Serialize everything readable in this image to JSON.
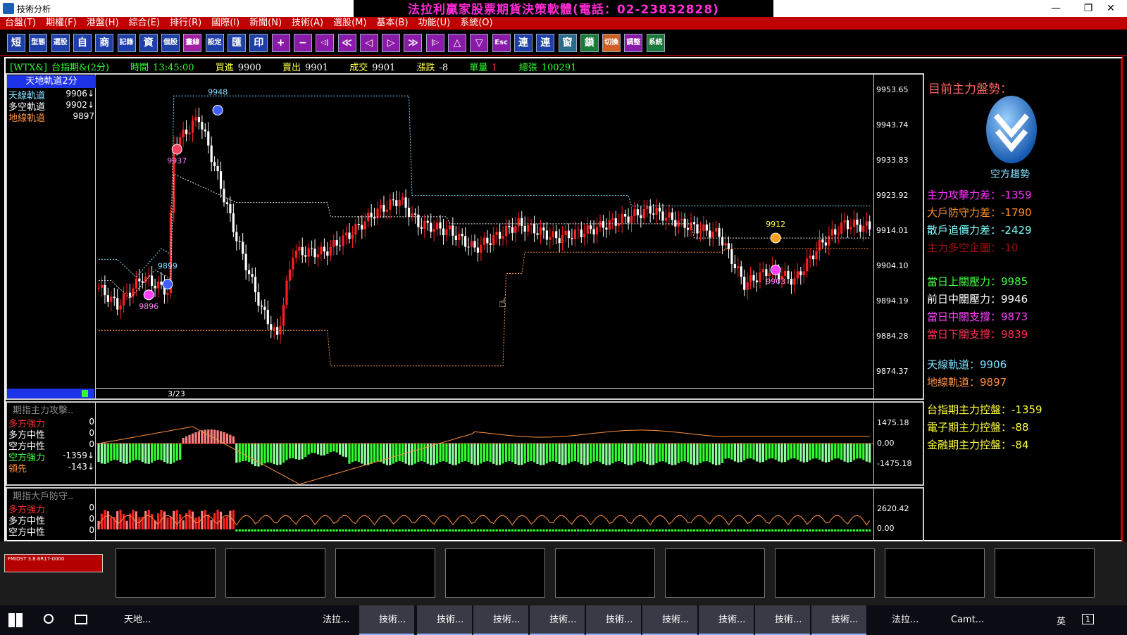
{
  "window": {
    "title": "技術分析",
    "banner": "法拉利贏家股票期貨決策軟體(電話：02-23832828)",
    "minimize": "—",
    "maximize": "❐",
    "close": "✕"
  },
  "menu": [
    "台盤(T)",
    "期權(F)",
    "港盤(H)",
    "綜合(E)",
    "排行(R)",
    "國際(I)",
    "新聞(N)",
    "技術(A)",
    "選股(M)",
    "基本(B)",
    "功能(U)",
    "系統(O)"
  ],
  "toolbar": [
    "短",
    "型態",
    "選股",
    "自",
    "商",
    "記錄",
    "資",
    "個股",
    "畫線",
    "設定",
    "匯",
    "印",
    "+",
    "−",
    "◁|",
    "≪",
    "◁",
    "▷",
    "≫",
    "|▷",
    "△",
    "▽",
    "Esc",
    "連",
    "連",
    "窗",
    "鎖",
    "切換",
    "調整",
    "系統"
  ],
  "quote": {
    "symbol": "[WTX&]",
    "name": "台指期&(2分)",
    "time_label": "時間",
    "time": "13:45:00",
    "bid_label": "買進",
    "bid": "9900",
    "ask_label": "賣出",
    "ask": "9901",
    "trade_label": "成交",
    "trade": "9901",
    "change_label": "漲跌",
    "change": "-8",
    "vol_label": "單量",
    "vol": "1",
    "total_label": "總張",
    "total": "100291"
  },
  "main_panel": {
    "title": "天地軌道2分",
    "legend": [
      {
        "label": "天線軌道",
        "value": "9906↓",
        "color": "#7fe0ff"
      },
      {
        "label": "多空軌道",
        "value": "9902↓",
        "color": "#ffffff"
      },
      {
        "label": "地線軌道",
        "value": "9897",
        "color": "#ff9040"
      }
    ],
    "date_label": "3/23",
    "annotations": [
      "9948",
      "9937",
      "9899",
      "9896",
      "9912",
      "9903"
    ]
  },
  "sub1": {
    "title": "期指主力攻擊..",
    "rows": [
      {
        "label": "多方強力",
        "value": "0",
        "color": "#ff3030"
      },
      {
        "label": "多方中性",
        "value": "0",
        "color": "#ffffff"
      },
      {
        "label": "空方中性",
        "value": "0",
        "color": "#ffffff"
      },
      {
        "label": "空方強力",
        "value": "-1359↓",
        "color": "#40ff40"
      },
      {
        "label": "領先",
        "value": "-143↓",
        "color": "#ff9040"
      }
    ],
    "yticks": [
      "1475.18",
      "0.00",
      "-1475.18"
    ]
  },
  "sub2": {
    "title": "期指大戶防守..",
    "rows": [
      {
        "label": "多方強力",
        "value": "0",
        "color": "#ff3030"
      },
      {
        "label": "多方中性",
        "value": "0",
        "color": "#ffffff"
      },
      {
        "label": "空方中性",
        "value": "0",
        "color": "#ffffff"
      }
    ],
    "yticks": [
      "2620.42",
      "0.00"
    ]
  },
  "chart_data": {
    "type": "candlestick",
    "y_ticks": [
      "9953.65",
      "9943.74",
      "9933.83",
      "9923.92",
      "9914.01",
      "9904.10",
      "9894.19",
      "9884.28",
      "9874.37"
    ],
    "ylim": [
      9870,
      9958
    ],
    "series": [
      {
        "name": "天線軌道",
        "last": 9906
      },
      {
        "name": "多空軌道",
        "last": 9902
      },
      {
        "name": "地線軌道",
        "last": 9897
      }
    ],
    "markers": [
      {
        "label": "9948",
        "value": 9948
      },
      {
        "label": "9937",
        "value": 9937
      },
      {
        "label": "9899",
        "value": 9899
      },
      {
        "label": "9896",
        "value": 9896
      },
      {
        "label": "9912",
        "value": 9912
      },
      {
        "label": "9903",
        "value": 9903
      }
    ]
  },
  "right": {
    "heading": "目前主力盤勢：",
    "trend_label": "空方趨勢",
    "lines": [
      {
        "text": "主力攻擊力差：-1359",
        "color": "#ff30ff"
      },
      {
        "text": "大戶防守力差：-1790",
        "color": "#ff9020"
      },
      {
        "text": "散戶追價力差：-2429",
        "color": "#80ffff"
      },
      {
        "text": "主力多空企圖：-10",
        "color": "#a01010"
      },
      {
        "text": "當日上關壓力：9985",
        "color": "#40ff40"
      },
      {
        "text": "前日中關壓力：9946",
        "color": "#ffffff"
      },
      {
        "text": "當日中關支撐：9873",
        "color": "#ff40ff"
      },
      {
        "text": "當日下關支撐：9839",
        "color": "#ff3050"
      },
      {
        "text": "天線軌道：9906",
        "color": "#7fe0ff"
      },
      {
        "text": "地線軌道：9897",
        "color": "#ff9040"
      },
      {
        "text": "台指期主力控盤：-1359",
        "color": "#ffff40"
      },
      {
        "text": "電子期主力控盤：-88",
        "color": "#ffff40"
      },
      {
        "text": "金融期主力控盤：-84",
        "color": "#ffff40"
      }
    ]
  },
  "thumbs": {
    "first_label": "FMIDST 3.8.6R17-0000"
  },
  "taskbar": {
    "items": [
      "天地...",
      "法拉...",
      "技術...",
      "技術...",
      "技術...",
      "技術...",
      "技術...",
      "技術...",
      "技術...",
      "技術...",
      "技術...",
      "法拉...",
      "Camt..."
    ],
    "ime": "英",
    "notify": "1"
  },
  "colors": {
    "up": "#ff2020",
    "down": "#ffffff",
    "bull_bar": "#ff8080",
    "bear_bar": "#30ff30",
    "accent": "#1d33e8"
  }
}
